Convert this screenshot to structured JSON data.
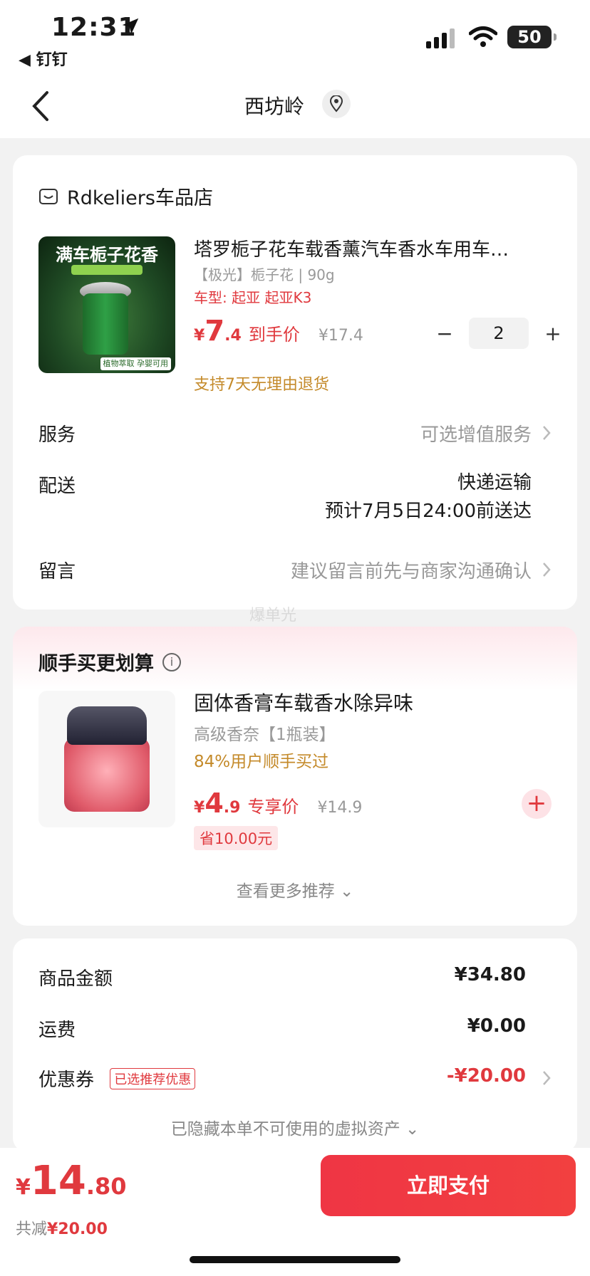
{
  "status_bar": {
    "time": "12:31",
    "back_app": "◀ 钉钉",
    "battery": "50"
  },
  "nav": {
    "title": "西坊岭"
  },
  "shop": {
    "name": "Rdkeliers车品店",
    "product": {
      "thumb_banner": "满车栀子花香",
      "thumb_tag": "植物萃取 孕婴可用",
      "title": "塔罗栀子花车载香薰汽车香水车用车…",
      "spec": "【极光】栀子花 | 90g",
      "model": "车型: 起亚 起亚K3",
      "price_currency": "¥",
      "price_int": "7",
      "price_dec": ".4",
      "price_label": "到手价",
      "orig_price": "¥17.4",
      "quantity": "2",
      "minus": "−",
      "plus": "+",
      "return_policy": "支持7天无理由退货"
    },
    "rows": {
      "service_label": "服务",
      "service_value": "可选增值服务",
      "ship_label": "配送",
      "ship_value1": "快递运输",
      "ship_value2": "预计7月5日24:00前送达",
      "note_label": "留言",
      "note_value": "建议留言前先与商家沟通确认"
    }
  },
  "recommend": {
    "title": "顺手买更划算",
    "info": "i",
    "item": {
      "name": "固体香膏车载香水除异味",
      "spec": "高级香奈【1瓶装】",
      "bought": "84%用户顺手买过",
      "price_currency": "¥",
      "price_int": "4",
      "price_dec": ".9",
      "price_label": "专享价",
      "orig_price": "¥14.9",
      "save": "省10.00元",
      "add": "+"
    },
    "more": "查看更多推荐 ⌄"
  },
  "summary": {
    "goods_label": "商品金额",
    "goods_value": "¥34.80",
    "ship_label": "运费",
    "ship_value": "¥0.00",
    "coupon_label": "优惠券",
    "coupon_badge": "已选推荐优惠",
    "coupon_value": "-¥20.00",
    "hidden": "已隐藏本单不可使用的虚拟资产 ⌄"
  },
  "bottom": {
    "currency": "¥",
    "total_int": "14",
    "total_dec": ".80",
    "reduce_label": "共减",
    "reduce_amount": "¥20.00",
    "pay_label": "立即支付"
  },
  "watermark": "爆单光",
  "colors": {
    "accent": "#e0393e",
    "gold": "#c48a2a"
  }
}
